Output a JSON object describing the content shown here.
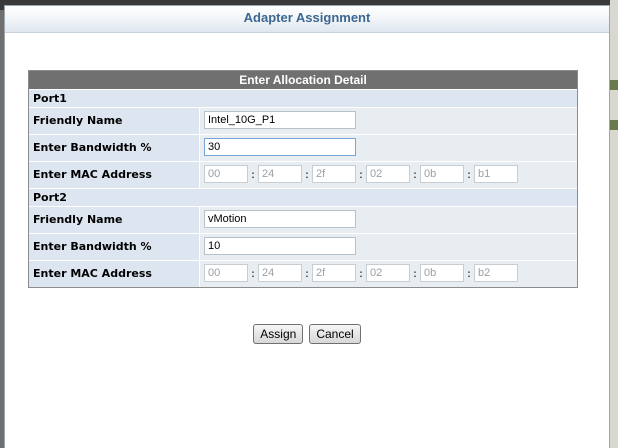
{
  "dialog": {
    "title": "Adapter Assignment"
  },
  "panel": {
    "header": "Enter Allocation Detail",
    "labels": {
      "friendly_name": "Friendly Name",
      "bandwidth": "Enter Bandwidth %",
      "mac": "Enter MAC Address"
    },
    "ports": [
      {
        "name": "Port1",
        "friendly_name": "Intel_10G_P1",
        "bandwidth": "30",
        "mac": [
          "00",
          "24",
          "2f",
          "02",
          "0b",
          "b1"
        ]
      },
      {
        "name": "Port2",
        "friendly_name": "vMotion",
        "bandwidth": "10",
        "mac": [
          "00",
          "24",
          "2f",
          "02",
          "0b",
          "b2"
        ]
      }
    ]
  },
  "buttons": {
    "assign": "Assign",
    "cancel": "Cancel"
  },
  "colors": {
    "title_text": "#3c6791",
    "panel_header_bg": "#707070",
    "label_bg": "#dde6f0"
  }
}
